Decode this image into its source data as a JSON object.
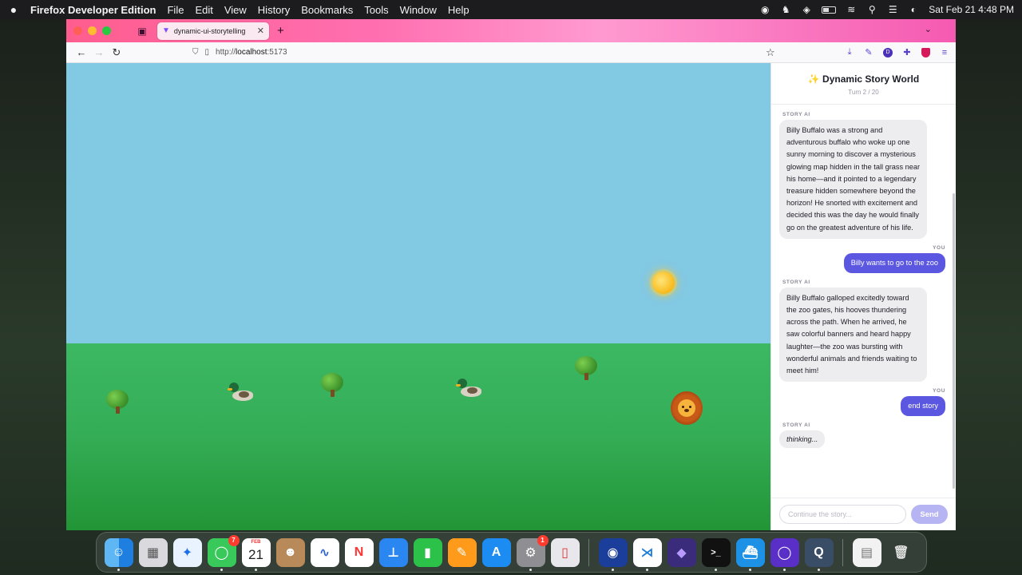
{
  "menubar": {
    "app_name": "Firefox Developer Edition",
    "menus": [
      "File",
      "Edit",
      "View",
      "History",
      "Bookmarks",
      "Tools",
      "Window",
      "Help"
    ],
    "clock": "Sat Feb 21  4:48 PM"
  },
  "browser": {
    "tab_title": "dynamic-ui-storytelling",
    "url_prefix": "http://",
    "url_host": "localhost",
    "url_port": ":5173"
  },
  "scene": {
    "sky_color": "#82c9e4",
    "ground_color": "#34ad56",
    "objects": [
      "sun",
      "tree",
      "duck",
      "tree",
      "duck",
      "tree",
      "lion"
    ]
  },
  "chat": {
    "title": "✨ Dynamic Story World",
    "turn": "Turn 2 / 20",
    "messages": [
      {
        "role": "STORY AI",
        "text": "Billy Buffalo was a strong and adventurous buffalo who woke up one sunny morning to discover a mysterious glowing map hidden in the tall grass near his home—and it pointed to a legendary treasure hidden somewhere beyond the horizon! He snorted with excitement and decided this was the day he would finally go on the greatest adventure of his life."
      },
      {
        "role": "YOU",
        "text": "Billy wants to go to the zoo"
      },
      {
        "role": "STORY AI",
        "text": "Billy Buffalo galloped excitedly toward the zoo gates, his hooves thundering across the path. When he arrived, he saw colorful banners and heard happy laughter—the zoo was bursting with wonderful animals and friends waiting to meet him!"
      },
      {
        "role": "YOU",
        "text": "end story"
      },
      {
        "role": "STORY AI",
        "text": "thinking..."
      }
    ],
    "input_placeholder": "Continue the story...",
    "input_value": "",
    "send_label": "Send",
    "accent_color": "#5b57e0"
  },
  "dock": {
    "messages_badge": "7",
    "calendar_month": "FEB",
    "calendar_day": "21",
    "settings_badge": "1"
  }
}
